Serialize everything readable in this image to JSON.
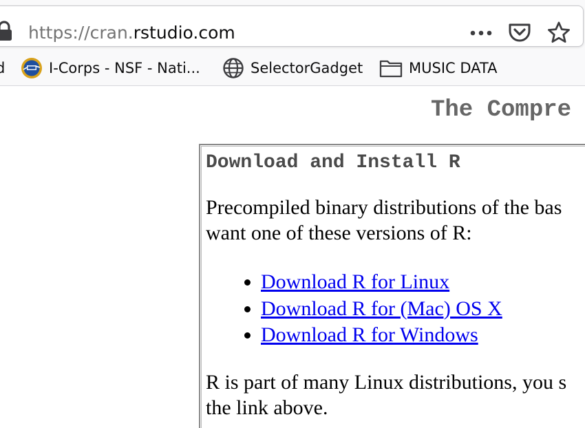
{
  "browser": {
    "url": {
      "scheme": "https://cran.",
      "domain": "rstudio.com"
    },
    "bookmarks": [
      {
        "label": "d"
      },
      {
        "label": "I-Corps - NSF - Nati..."
      },
      {
        "label": "SelectorGadget"
      },
      {
        "label": "MUSIC DATA"
      }
    ],
    "icons": {
      "lock": "lock-icon",
      "page_actions": "ellipsis-icon",
      "pocket": "pocket-icon",
      "bookmark_star": "star-icon",
      "nsf": "nsf-logo-icon",
      "globe": "globe-icon",
      "folder": "folder-icon"
    }
  },
  "page": {
    "heading": "The Compre",
    "section": {
      "title": "Download and Install R",
      "intro_line1": "Precompiled binary distributions of the bas",
      "intro_line2": "want one of these versions of R:",
      "links": [
        {
          "label": "Download R for Linux"
        },
        {
          "label": "Download R for (Mac) OS X"
        },
        {
          "label": "Download R for Windows"
        }
      ],
      "outro_line1": "R is part of many Linux distributions, you s",
      "outro_line2": "the link above."
    }
  },
  "colors": {
    "link": "#0000ee",
    "heading_gray": "#666666",
    "title_gray": "#4a4a4a",
    "toolbar_bg": "#f9f9fa"
  }
}
